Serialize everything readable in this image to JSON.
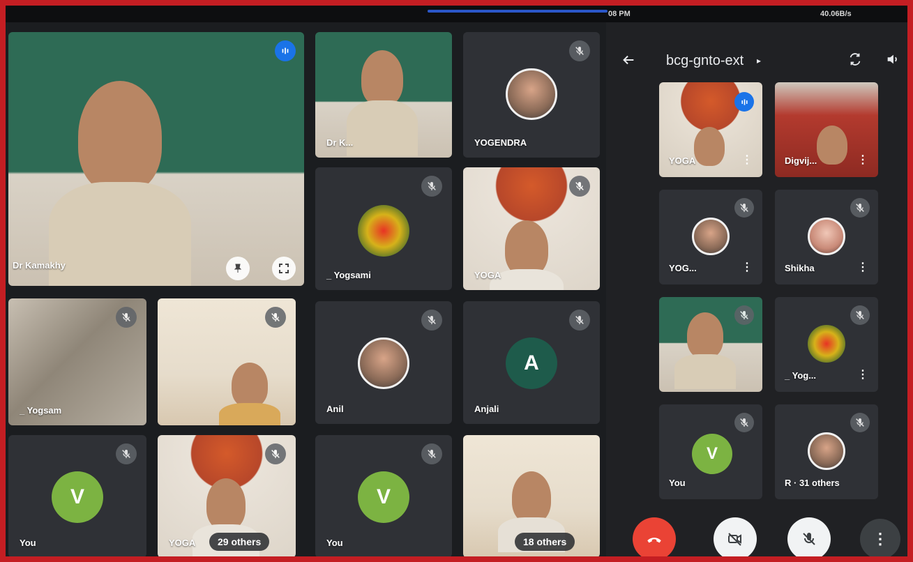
{
  "status_bar": {
    "time": "08 PM",
    "battery": "40.06B/s"
  },
  "grid": {
    "tiles": [
      {
        "name": "Dr Kamakhy"
      },
      {
        "name": "Dr K..."
      },
      {
        "name": "YOGENDRA"
      },
      {
        "name": "_ Yogsami"
      },
      {
        "name": "YOGA"
      },
      {
        "name": "_ Yogsam"
      },
      {
        "name": ""
      },
      {
        "name": "Anil"
      },
      {
        "name": "Anjali",
        "avatar_letter": "A"
      },
      {
        "name": "You",
        "avatar_letter": "V"
      },
      {
        "name": "YOGA",
        "overflow": "29 others"
      },
      {
        "name": "You",
        "avatar_letter": "V"
      },
      {
        "name": "",
        "overflow": "18 others"
      }
    ]
  },
  "side_panel": {
    "meeting_code": "bcg-gnto-ext",
    "tiles": [
      {
        "name": "YOGA"
      },
      {
        "name": "Digvij..."
      },
      {
        "name": "YOG..."
      },
      {
        "name": "Shikha"
      },
      {
        "name": ""
      },
      {
        "name": "_ Yog..."
      },
      {
        "name": "You",
        "avatar_letter": "V"
      },
      {
        "name": "R · 31 others"
      }
    ]
  },
  "colors": {
    "frame_border": "#c41e23",
    "end_call": "#ea4335",
    "avatar_green": "#7cb342",
    "avatar_teal": "#1e5b4b",
    "speaking_blue": "#1a73e8"
  },
  "icons": [
    "mic-off-icon",
    "speaking-icon",
    "pin-icon",
    "fullscreen-icon",
    "back-arrow-icon",
    "switch-camera-icon",
    "speaker-icon",
    "end-call-icon",
    "camera-off-icon",
    "more-vert-icon"
  ]
}
